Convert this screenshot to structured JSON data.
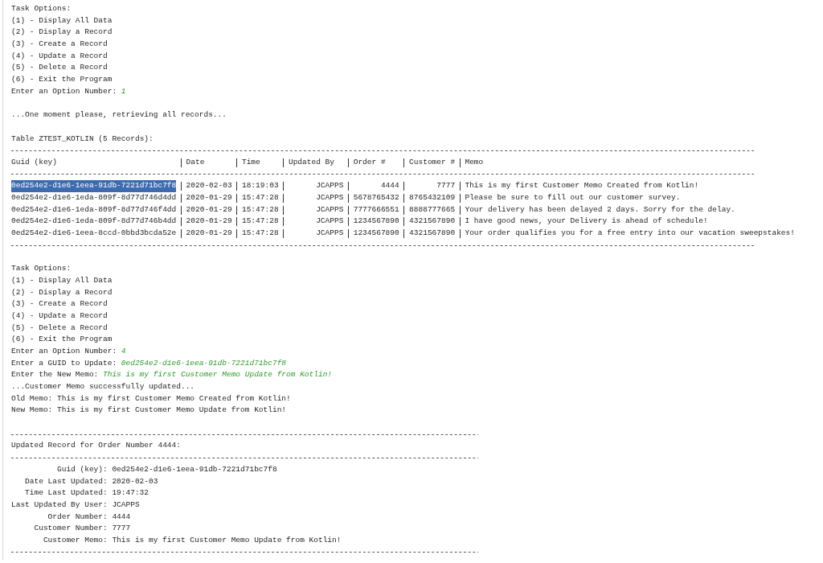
{
  "lines": [
    {
      "kind": "text",
      "text": "Task Options:"
    },
    {
      "kind": "text",
      "text": "(1) - Display All Data"
    },
    {
      "kind": "text",
      "text": "(2) - Display a Record"
    },
    {
      "kind": "text",
      "text": "(3) - Create a Record"
    },
    {
      "kind": "text",
      "text": "(4) - Update a Record"
    },
    {
      "kind": "text",
      "text": "(5) - Delete a Record"
    },
    {
      "kind": "text",
      "text": "(6) - Exit the Program"
    },
    {
      "kind": "prompt",
      "text": "Enter an Option Number:",
      "input": "1"
    },
    {
      "kind": "blank"
    },
    {
      "kind": "text",
      "text": "...One moment please, retrieving all records..."
    },
    {
      "kind": "blank"
    },
    {
      "kind": "text",
      "text": "Table ZTEST_KOTLIN (5 Records):"
    },
    {
      "kind": "table",
      "columns": [
        {
          "label": "Guid (key)"
        },
        {
          "label": "Date"
        },
        {
          "label": "Time"
        },
        {
          "label": "Updated By"
        },
        {
          "label": "Order #"
        },
        {
          "label": "Customer #"
        },
        {
          "label": "Memo"
        }
      ],
      "rows": [
        {
          "selected": true,
          "cells": [
            "0ed254e2-d1e6-1eea-91db-7221d71bc7f8",
            "2020-02-03",
            "18:19:03",
            "JCAPPS",
            "4444",
            "7777",
            "This is my first Customer Memo Created from Kotlin!"
          ]
        },
        {
          "selected": false,
          "cells": [
            "0ed254e2-d1e6-1eda-809f-8d77d746d4dd",
            "2020-01-29",
            "15:47:28",
            "JCAPPS",
            "5678765432",
            "8765432109",
            "Please be sure to fill out our customer survey."
          ]
        },
        {
          "selected": false,
          "cells": [
            "0ed254e2-d1e6-1eda-809f-8d77d746f4dd",
            "2020-01-29",
            "15:47:28",
            "JCAPPS",
            "7777666551",
            "8888777665",
            "Your delivery has been delayed 2 days. Sorry for the delay."
          ]
        },
        {
          "selected": false,
          "cells": [
            "0ed254e2-d1e6-1eda-809f-8d77d746b4dd",
            "2020-01-29",
            "15:47:28",
            "JCAPPS",
            "1234567890",
            "4321567890",
            "I have good news, your Delivery is ahead of schedule!"
          ]
        },
        {
          "selected": false,
          "cells": [
            "0ed254e2-d1e6-1eea-8ccd-0bbd3bcda52e",
            "2020-01-29",
            "15:47:28",
            "JCAPPS",
            "1234567890",
            "4321567890",
            "Your order qualifies you for a free entry into our vacation sweepstakes!"
          ]
        }
      ]
    },
    {
      "kind": "blank"
    },
    {
      "kind": "text",
      "text": "Task Options:"
    },
    {
      "kind": "text",
      "text": "(1) - Display All Data"
    },
    {
      "kind": "text",
      "text": "(2) - Display a Record"
    },
    {
      "kind": "text",
      "text": "(3) - Create a Record"
    },
    {
      "kind": "text",
      "text": "(4) - Update a Record"
    },
    {
      "kind": "text",
      "text": "(5) - Delete a Record"
    },
    {
      "kind": "text",
      "text": "(6) - Exit the Program"
    },
    {
      "kind": "prompt",
      "text": "Enter an Option Number:",
      "input": "4"
    },
    {
      "kind": "prompt",
      "text": "Enter a GUID to Update:",
      "input": "0ed254e2-d1e6-1eea-91db-7221d71bc7f8"
    },
    {
      "kind": "prompt",
      "text": "Enter the New Memo:",
      "input": "This is my first Customer Memo Update from Kotlin!"
    },
    {
      "kind": "text",
      "text": "...Customer Memo successfully updated..."
    },
    {
      "kind": "text",
      "text": "Old Memo: This is my first Customer Memo Created from Kotlin!"
    },
    {
      "kind": "text",
      "text": "New Memo: This is my first Customer Memo Update from Kotlin!"
    },
    {
      "kind": "blank"
    },
    {
      "kind": "rule"
    },
    {
      "kind": "text",
      "text": "Updated Record for Order Number 4444:"
    },
    {
      "kind": "rule"
    },
    {
      "kind": "field",
      "label": "Guid (key):",
      "value": "0ed254e2-d1e6-1eea-91db-7221d71bc7f8"
    },
    {
      "kind": "field",
      "label": "Date Last Updated:",
      "value": "2020-02-03"
    },
    {
      "kind": "field",
      "label": "Time Last Updated:",
      "value": "19:47:32"
    },
    {
      "kind": "field",
      "label": "Last Updated By User:",
      "value": "JCAPPS"
    },
    {
      "kind": "field",
      "label": "Order Number:",
      "value": "4444"
    },
    {
      "kind": "field",
      "label": "Customer Number:",
      "value": "7777"
    },
    {
      "kind": "field",
      "label": "Customer Memo:",
      "value": "This is my first Customer Memo Update from Kotlin!"
    },
    {
      "kind": "rule"
    }
  ]
}
